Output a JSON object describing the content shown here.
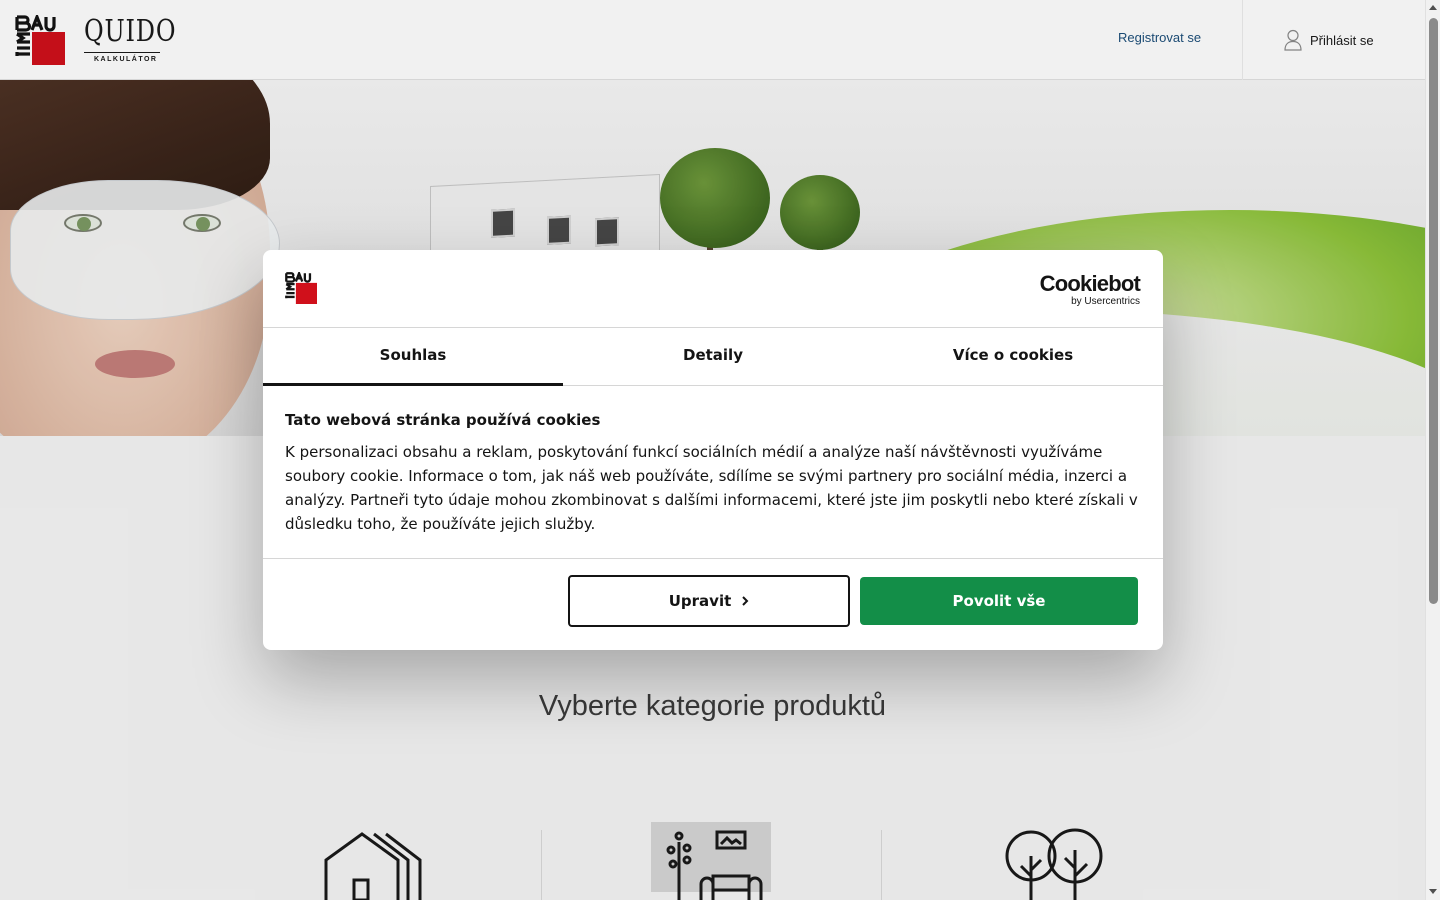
{
  "header": {
    "quido_logo_text": "QUIDO",
    "quido_logo_sub": "KALKULÁTOR",
    "register_label": "Registrovat se",
    "login_label": "Přihlásit se"
  },
  "main": {
    "section_title": "Vyberte kategorie produktů",
    "categories": [
      {
        "icon": "houses-icon"
      },
      {
        "icon": "interior-icon"
      },
      {
        "icon": "trees-icon"
      }
    ]
  },
  "cookie_dialog": {
    "provider_logo": "Cookiebot",
    "provider_sub": "by Usercentrics",
    "tabs": [
      {
        "label": "Souhlas",
        "active": true
      },
      {
        "label": "Detaily",
        "active": false
      },
      {
        "label": "Více o cookies",
        "active": false
      }
    ],
    "title": "Tato webová stránka používá cookies",
    "text": "K personalizaci obsahu a reklam, poskytování funkcí sociálních médií a analýze naší návštěvnosti využíváme soubory cookie. Informace o tom, jak náš web používáte, sdílíme se svými partnery pro sociální média, inzerci a analýzy. Partneři tyto údaje mohou zkombinovat s dalšími informacemi, které jste jim poskytli nebo které získali v důsledku toho, že používáte jejich služby.",
    "customize_label": "Upravit",
    "allow_all_label": "Povolit vše"
  },
  "colors": {
    "brand_red": "#d0101b",
    "accept_green": "#138e48",
    "link_blue": "#1d4f7a"
  }
}
